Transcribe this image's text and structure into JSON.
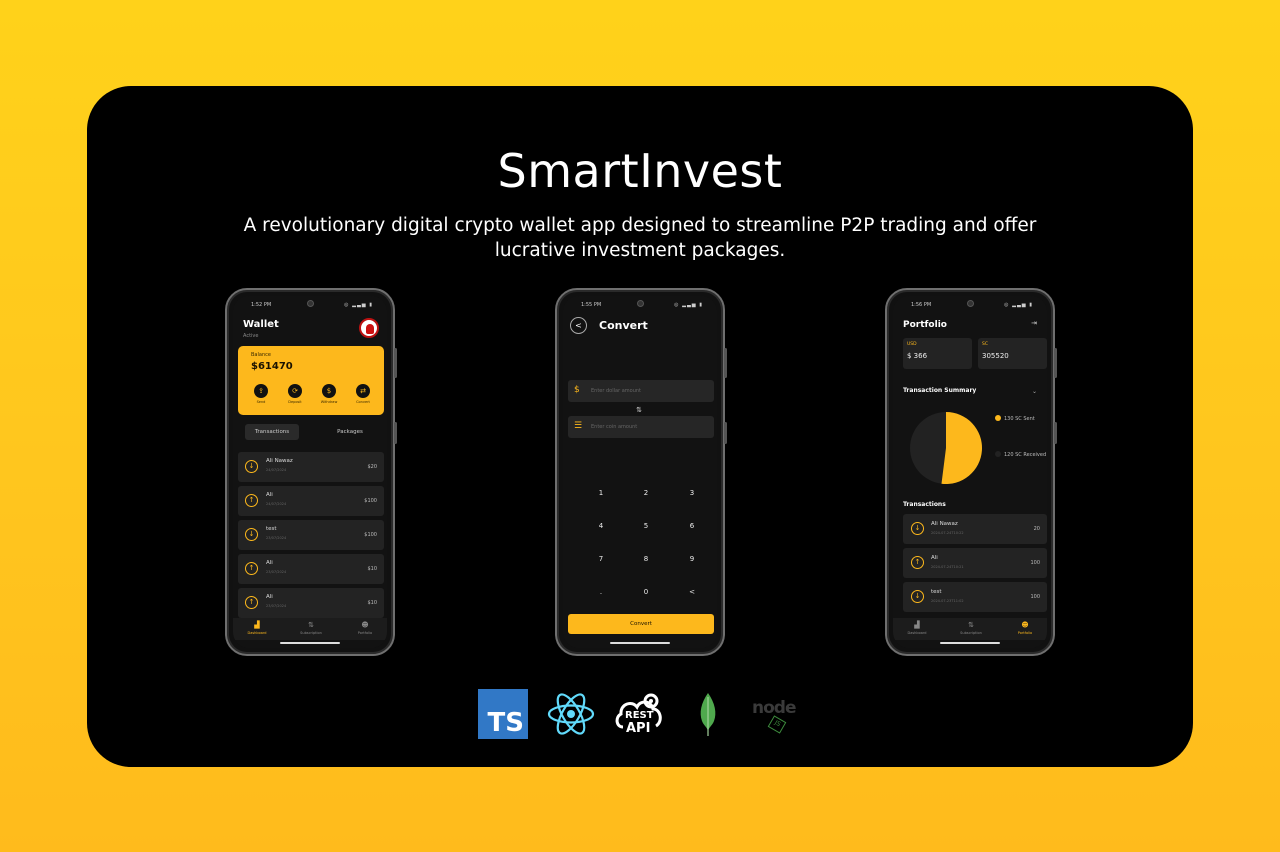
{
  "header": {
    "title": "SmartInvest",
    "subtitle": "A revolutionary digital crypto wallet app designed to streamline P2P trading and offer lucrative investment packages."
  },
  "colors": {
    "accent": "#fdb81c",
    "card_bg": "#000000",
    "background": "#ffcc1e"
  },
  "wallet_screen": {
    "status_time": "1:52 PM",
    "title": "Wallet",
    "subtitle": "Active",
    "balance_label": "Balance",
    "balance_value": "$61470",
    "actions": [
      {
        "icon": "send-icon",
        "glyph": "⇪",
        "label": "Send"
      },
      {
        "icon": "deposit-icon",
        "glyph": "⟳",
        "label": "Deposit"
      },
      {
        "icon": "withdraw-icon",
        "glyph": "$",
        "label": "Withdraw"
      },
      {
        "icon": "convert-icon",
        "glyph": "⇄",
        "label": "Convert"
      }
    ],
    "tabs": [
      "Transactions",
      "Packages"
    ],
    "transactions": [
      {
        "name": "Ali Nawaz",
        "date": "24/07/2024",
        "amount": "$20",
        "direction": "down"
      },
      {
        "name": "Ali",
        "date": "24/07/2024",
        "amount": "$100",
        "direction": "up"
      },
      {
        "name": "test",
        "date": "23/07/2024",
        "amount": "$100",
        "direction": "down"
      },
      {
        "name": "Ali",
        "date": "23/07/2024",
        "amount": "$10",
        "direction": "up"
      },
      {
        "name": "Ali",
        "date": "23/07/2024",
        "amount": "$10",
        "direction": "up"
      }
    ],
    "nav": [
      {
        "label": "Dashboard",
        "active": true
      },
      {
        "label": "Subscription",
        "active": false
      },
      {
        "label": "Portfolio",
        "active": false
      }
    ]
  },
  "convert_screen": {
    "status_time": "1:55 PM",
    "title": "Convert",
    "field1_placeholder": "Enter dollar amount",
    "field2_placeholder": "Enter coin amount",
    "keys": [
      "1",
      "2",
      "3",
      "4",
      "5",
      "6",
      "7",
      "8",
      "9",
      ".",
      "0",
      "<"
    ],
    "button_label": "Convert"
  },
  "portfolio_screen": {
    "status_time": "1:56 PM",
    "title": "Portfolio",
    "usd_label": "USD",
    "usd_value": "$ 366",
    "sc_label": "SC",
    "sc_value": "305520",
    "summary_title": "Transaction Summary",
    "legend": [
      {
        "label": "130 SC Sent",
        "color": "#fdb81c"
      },
      {
        "label": "120 SC Received",
        "color": "#222222"
      }
    ],
    "pie_values": [
      130,
      120
    ],
    "transactions_title": "Transactions",
    "transactions": [
      {
        "name": "Ali Nawaz",
        "date": "2024-07-24T10:22",
        "amount": "20",
        "direction": "down"
      },
      {
        "name": "Ali",
        "date": "2024-07-24T10:21",
        "amount": "100",
        "direction": "up"
      },
      {
        "name": "test",
        "date": "2024-07-23T11:02",
        "amount": "100",
        "direction": "down"
      }
    ],
    "nav": [
      {
        "label": "Dashboard",
        "active": false
      },
      {
        "label": "Subscription",
        "active": false
      },
      {
        "label": "Portfolio",
        "active": true
      }
    ]
  },
  "tech_stack": [
    {
      "name": "TypeScript",
      "icon": "typescript-icon",
      "text": "TS"
    },
    {
      "name": "React",
      "icon": "react-icon"
    },
    {
      "name": "REST API",
      "icon": "rest-api-icon",
      "text1": "REST",
      "text2": "API"
    },
    {
      "name": "MongoDB",
      "icon": "mongodb-icon"
    },
    {
      "name": "Node.js",
      "icon": "nodejs-icon",
      "text": "node",
      "badge": "JS"
    }
  ]
}
